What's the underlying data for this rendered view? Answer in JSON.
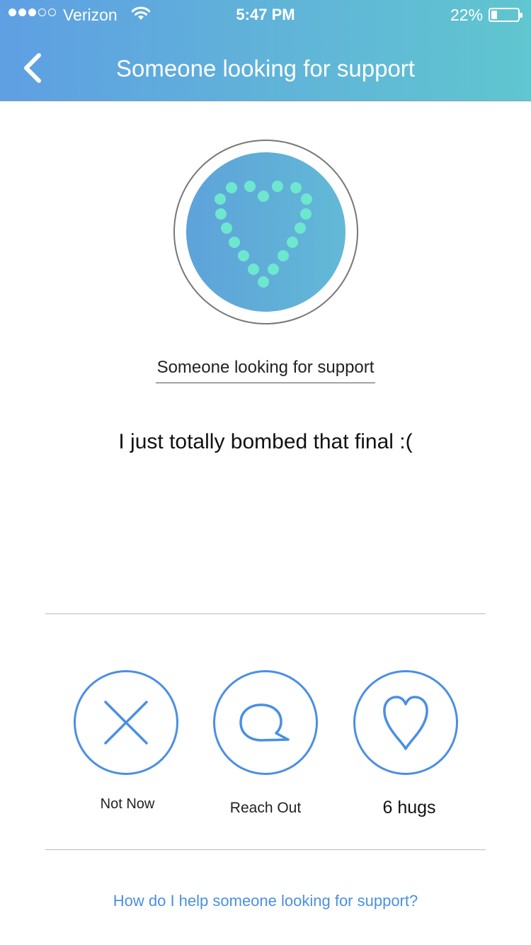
{
  "status_bar": {
    "carrier": "Verizon",
    "time": "5:47 PM",
    "battery": "22%",
    "signal_bars_filled": 3,
    "signal_bars_total": 5,
    "battery_level": 0.22
  },
  "header": {
    "title": "Someone looking for support",
    "back_icon": "chevron-left-icon"
  },
  "avatar": {
    "icon": "dotted-heart-icon",
    "dot_color": "#6ee7cf"
  },
  "post": {
    "poster_name": "Someone looking for support",
    "message": "I just totally bombed that final :("
  },
  "actions": [
    {
      "label": "Not Now",
      "icon": "close-icon"
    },
    {
      "label": "Reach Out",
      "icon": "speech-bubble-icon"
    },
    {
      "label": "6 hugs",
      "icon": "heart-icon"
    }
  ],
  "help_link": "How do I help someone looking for support?",
  "colors": {
    "accent": "#4a8fe4",
    "link": "#4a90e2",
    "header_start": "#5f9fe3",
    "header_end": "#60c6cf"
  }
}
